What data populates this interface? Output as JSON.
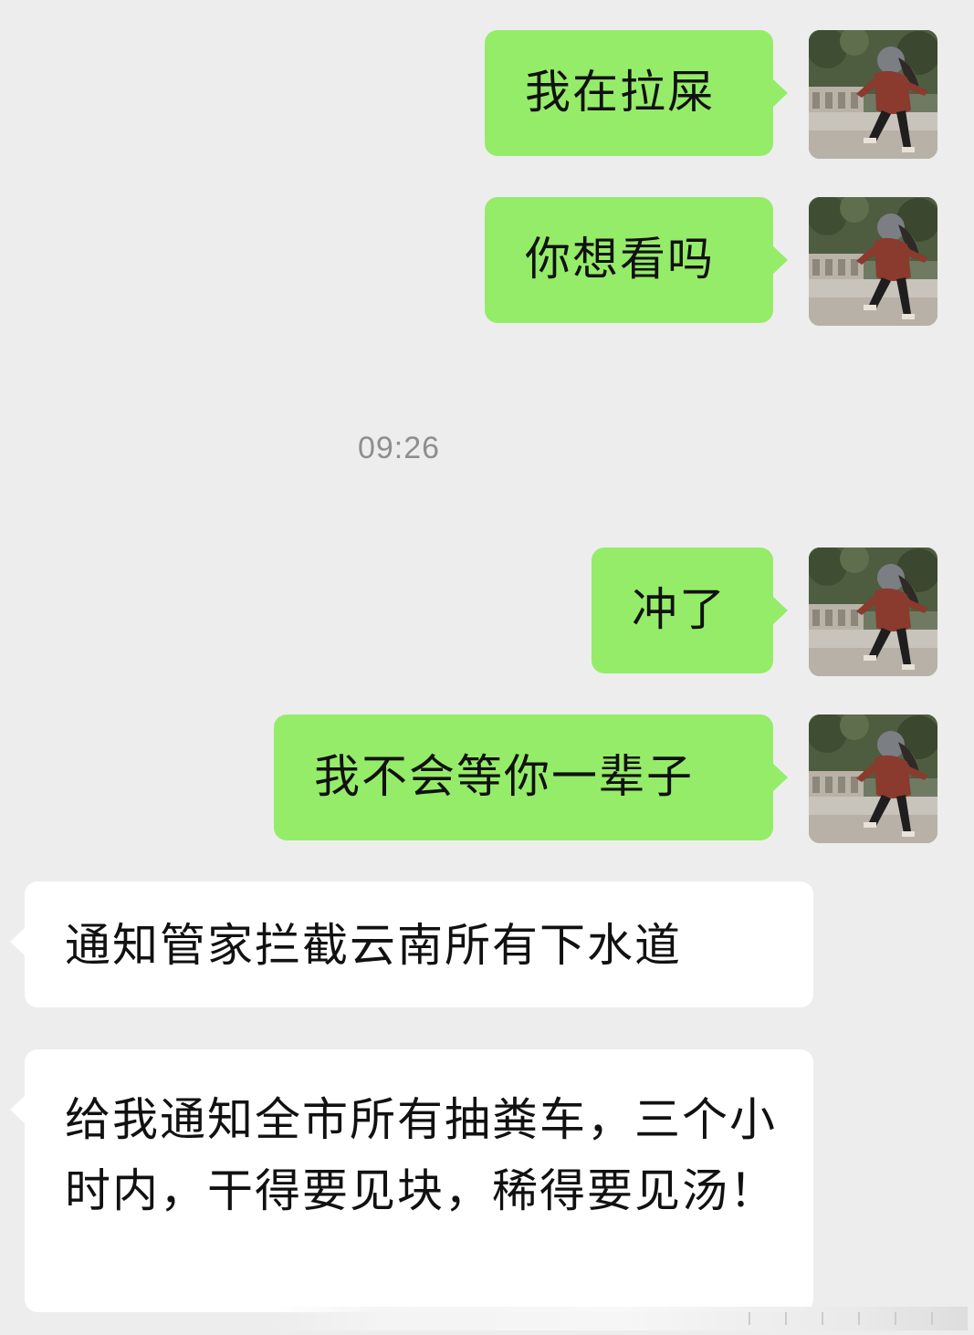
{
  "chat": {
    "messages": [
      {
        "sender": "me",
        "text": "我在拉屎"
      },
      {
        "sender": "me",
        "text": "你想看吗"
      },
      {
        "sender": "me",
        "text": "冲了"
      },
      {
        "sender": "me",
        "text": "我不会等你一辈子"
      },
      {
        "sender": "other",
        "text": "通知管家拦截云南所有下水道"
      },
      {
        "sender": "other",
        "text": "给我通知全市所有抽粪车，三个小时内，干得要见块，稀得要见汤！"
      }
    ],
    "timestamp": "09:26"
  },
  "colors": {
    "background": "#EDEDED",
    "sent_bubble": "#95EC69",
    "received_bubble": "#FFFFFF",
    "timestamp_text": "#8E8E8E"
  },
  "icons": {
    "avatar": "running-girl-avatar"
  }
}
